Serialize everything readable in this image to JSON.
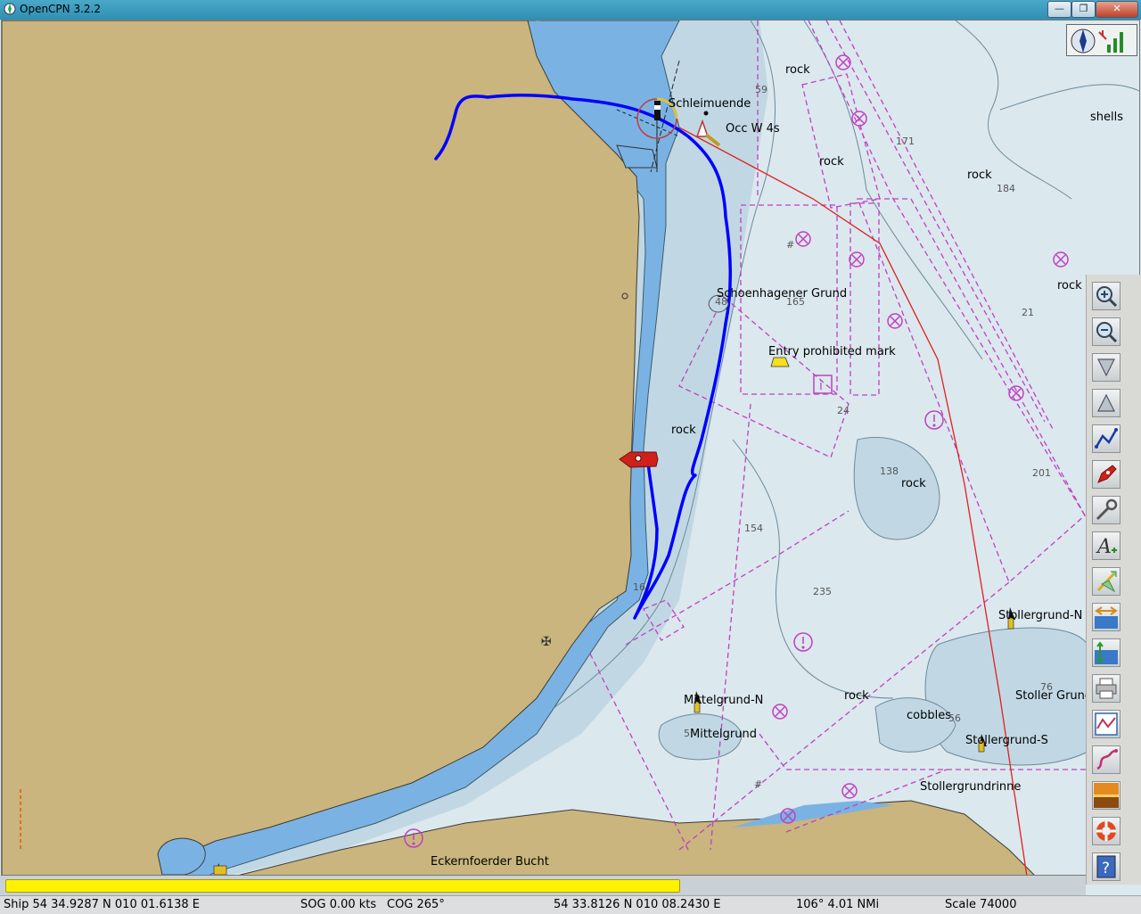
{
  "window": {
    "title": "OpenCPN 3.2.2",
    "minimize": "—",
    "restore": "❐",
    "close": "✕"
  },
  "chart_labels": {
    "schleimuende": "Schleimuende",
    "light": "Occ W 4s",
    "rock_n": "rock",
    "rock_mid": "rock",
    "rock_ne": "rock",
    "rock_e": "rock",
    "shells": "shells",
    "schoenhagener": "Schoenhagener Grund",
    "entry_prohibited": "Entry prohibited mark",
    "rock_center": "rock",
    "rock_se": "rock",
    "stollergrund_n": "Stollergrund-N",
    "stoller_grund": "Stoller Grund",
    "mittelgrund_n": "Mittelgrund-N",
    "rock_south": "rock",
    "cobbles": "cobbles",
    "mittelgrund": "Mittelgrund",
    "stollergrund_s": "Stollergrund-S",
    "stollergrundrinne": "Stollergrundrinne",
    "eckernfoerder": "Eckernfoerder Bucht"
  },
  "soundings": [
    {
      "text": "59"
    },
    {
      "text": "171"
    },
    {
      "text": "184"
    },
    {
      "text": "165"
    },
    {
      "text": "21"
    },
    {
      "text": "24"
    },
    {
      "text": "138"
    },
    {
      "text": "201"
    },
    {
      "text": "154"
    },
    {
      "text": "16"
    },
    {
      "text": "235"
    },
    {
      "text": "76"
    },
    {
      "text": "56"
    },
    {
      "text": "5"
    },
    {
      "text": "#"
    },
    {
      "text": "#"
    },
    {
      "text": "48"
    }
  ],
  "toolbar": {
    "tools": [
      "zoom-in",
      "zoom-out",
      "scale-in",
      "scale-out",
      "route",
      "ship-follow",
      "settings",
      "text",
      "current",
      "tide",
      "tide-level",
      "print",
      "route-manager",
      "track",
      "color-scheme",
      "man-overboard",
      "help"
    ]
  },
  "status": {
    "ship": "Ship 54 34.9287 N   010 01.6138 E",
    "sog": "SOG 0.00 kts",
    "cog": "COG 265°",
    "cursor": "54 33.8126 N   010 08.2430 E",
    "bearing": "106°  4.01 NMi",
    "scale": "Scale 74000"
  },
  "progress": {
    "value": 0.62
  },
  "colors": {
    "land": "#c9b57d",
    "shallow": "#7ab3e3",
    "mid": "#c1d8e4",
    "deep": "#dbe8ee",
    "track": "#0000ff",
    "restricted": "#c040c0",
    "route": "#e02020"
  }
}
